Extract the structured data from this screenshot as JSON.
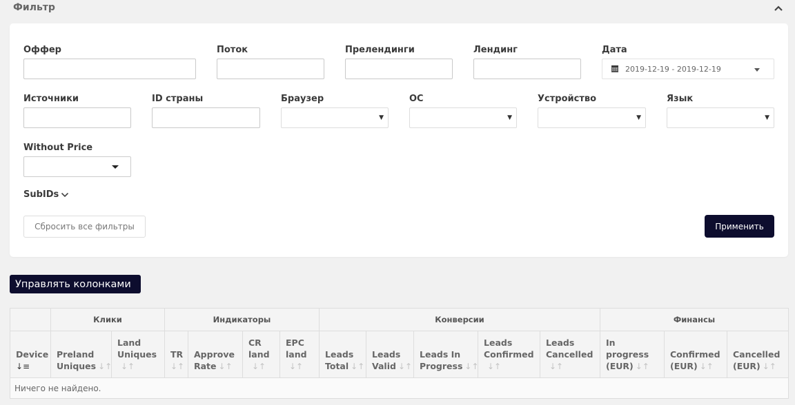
{
  "filter": {
    "title": "Фильтр",
    "fields": {
      "offer": "Оффер",
      "stream": "Поток",
      "prelandings": "Прелендинги",
      "landing": "Лендинг",
      "date": "Дата",
      "date_value": "2019-12-19 - 2019-12-19",
      "sources": "Источники",
      "country_id": "ID страны",
      "browser": "Браузер",
      "os": "ОС",
      "device": "Устройство",
      "language": "Язык",
      "without_price": "Without Price"
    },
    "subids_label": "SubIDs",
    "reset_label": "Сбросить все фильтры",
    "apply_label": "Применить"
  },
  "manage_columns_label": "Управлять колонками",
  "table": {
    "groups": {
      "clicks": "Клики",
      "indicators": "Индикаторы",
      "conversions": "Конверсии",
      "finance": "Финансы"
    },
    "columns": [
      {
        "l1": "Device",
        "l2": ""
      },
      {
        "l1": "Preland",
        "l2": "Uniques"
      },
      {
        "l1": "Land",
        "l2": "Uniques"
      },
      {
        "l1": "TR",
        "l2": ""
      },
      {
        "l1": "Approve",
        "l2": "Rate"
      },
      {
        "l1": "CR",
        "l2": "land"
      },
      {
        "l1": "EPC",
        "l2": "land"
      },
      {
        "l1": "Leads",
        "l2": "Total"
      },
      {
        "l1": "Leads",
        "l2": "Valid"
      },
      {
        "l1": "Leads In",
        "l2": "Progress"
      },
      {
        "l1": "Leads",
        "l2": "Confirmed"
      },
      {
        "l1": "Leads",
        "l2": "Cancelled"
      },
      {
        "l1": "In progress",
        "l2": "(EUR)"
      },
      {
        "l1": "Confirmed",
        "l2": "(EUR)"
      },
      {
        "l1": "Cancelled",
        "l2": "(EUR)"
      }
    ],
    "empty_message": "Ничего не найдено."
  },
  "colors": {
    "primary": "#0d0d2e",
    "background": "#f1f1f1"
  }
}
